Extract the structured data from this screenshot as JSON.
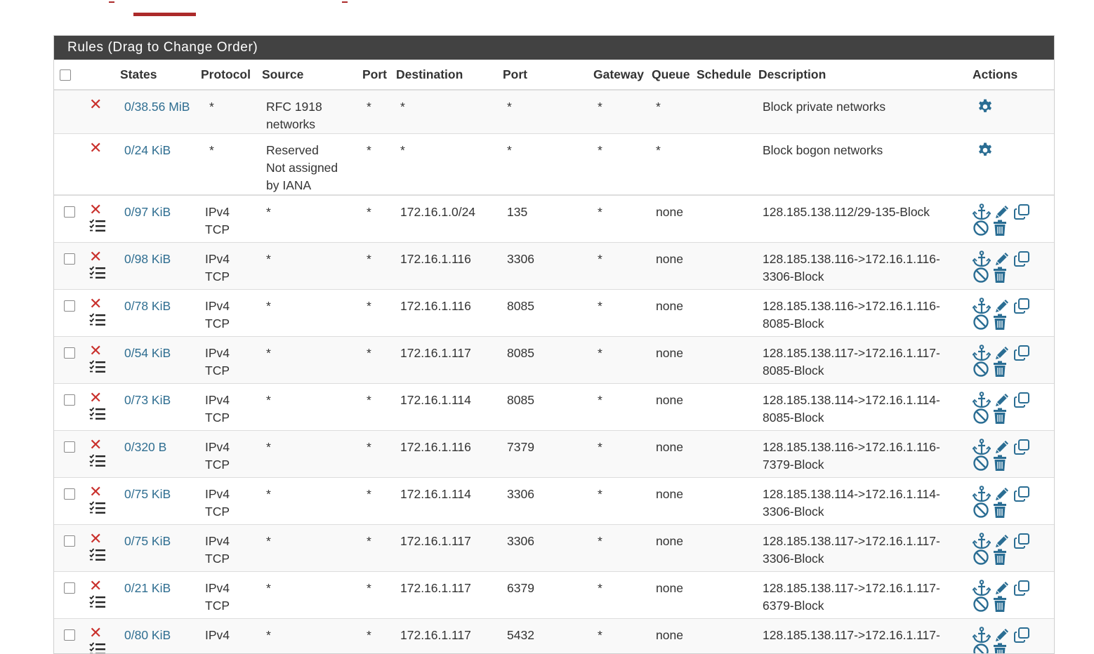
{
  "panel": {
    "title": "Rules (Drag to Change Order)"
  },
  "columns": {
    "states": "States",
    "protocol": "Protocol",
    "source": "Source",
    "source_port": "Port",
    "destination": "Destination",
    "dest_port": "Port",
    "gateway": "Gateway",
    "queue": "Queue",
    "schedule": "Schedule",
    "description": "Description",
    "actions": "Actions"
  },
  "fixed_rules": [
    {
      "states": "0/38.56 MiB",
      "protocol": "*",
      "source_line1": "RFC 1918",
      "source_line2": "networks",
      "source_line3": "",
      "source_port": "*",
      "destination": "*",
      "dest_port": "*",
      "gateway": "*",
      "queue": "*",
      "schedule": "",
      "description": "Block private networks"
    },
    {
      "states": "0/24 KiB",
      "protocol": "*",
      "source_line1": "Reserved",
      "source_line2": "Not assigned",
      "source_line3": "by IANA",
      "source_port": "*",
      "destination": "*",
      "dest_port": "*",
      "gateway": "*",
      "queue": "*",
      "schedule": "",
      "description": "Block bogon networks"
    }
  ],
  "rules": [
    {
      "states": "0/97 KiB",
      "proto1": "IPv4",
      "proto2": "TCP",
      "source": "*",
      "source_port": "*",
      "destination": "172.16.1.0/24",
      "dest_port": "135",
      "gateway": "*",
      "queue": "none",
      "schedule": "",
      "desc1": "128.185.138.112/29-135-Block",
      "desc2": ""
    },
    {
      "states": "0/98 KiB",
      "proto1": "IPv4",
      "proto2": "TCP",
      "source": "*",
      "source_port": "*",
      "destination": "172.16.1.116",
      "dest_port": "3306",
      "gateway": "*",
      "queue": "none",
      "schedule": "",
      "desc1": "128.185.138.116->172.16.1.116-",
      "desc2": "3306-Block"
    },
    {
      "states": "0/78 KiB",
      "proto1": "IPv4",
      "proto2": "TCP",
      "source": "*",
      "source_port": "*",
      "destination": "172.16.1.116",
      "dest_port": "8085",
      "gateway": "*",
      "queue": "none",
      "schedule": "",
      "desc1": "128.185.138.116->172.16.1.116-",
      "desc2": "8085-Block"
    },
    {
      "states": "0/54 KiB",
      "proto1": "IPv4",
      "proto2": "TCP",
      "source": "*",
      "source_port": "*",
      "destination": "172.16.1.117",
      "dest_port": "8085",
      "gateway": "*",
      "queue": "none",
      "schedule": "",
      "desc1": "128.185.138.117->172.16.1.117-",
      "desc2": "8085-Block"
    },
    {
      "states": "0/73 KiB",
      "proto1": "IPv4",
      "proto2": "TCP",
      "source": "*",
      "source_port": "*",
      "destination": "172.16.1.114",
      "dest_port": "8085",
      "gateway": "*",
      "queue": "none",
      "schedule": "",
      "desc1": "128.185.138.114->172.16.1.114-",
      "desc2": "8085-Block"
    },
    {
      "states": "0/320 B",
      "proto1": "IPv4",
      "proto2": "TCP",
      "source": "*",
      "source_port": "*",
      "destination": "172.16.1.116",
      "dest_port": "7379",
      "gateway": "*",
      "queue": "none",
      "schedule": "",
      "desc1": "128.185.138.116->172.16.1.116-",
      "desc2": "7379-Block"
    },
    {
      "states": "0/75 KiB",
      "proto1": "IPv4",
      "proto2": "TCP",
      "source": "*",
      "source_port": "*",
      "destination": "172.16.1.114",
      "dest_port": "3306",
      "gateway": "*",
      "queue": "none",
      "schedule": "",
      "desc1": "128.185.138.114->172.16.1.114-",
      "desc2": "3306-Block"
    },
    {
      "states": "0/75 KiB",
      "proto1": "IPv4",
      "proto2": "TCP",
      "source": "*",
      "source_port": "*",
      "destination": "172.16.1.117",
      "dest_port": "3306",
      "gateway": "*",
      "queue": "none",
      "schedule": "",
      "desc1": "128.185.138.117->172.16.1.117-",
      "desc2": "3306-Block"
    },
    {
      "states": "0/21 KiB",
      "proto1": "IPv4",
      "proto2": "TCP",
      "source": "*",
      "source_port": "*",
      "destination": "172.16.1.117",
      "dest_port": "6379",
      "gateway": "*",
      "queue": "none",
      "schedule": "",
      "desc1": "128.185.138.117->172.16.1.117-",
      "desc2": "6379-Block"
    },
    {
      "states": "0/80 KiB",
      "proto1": "IPv4",
      "proto2": "",
      "source": "*",
      "source_port": "*",
      "destination": "172.16.1.117",
      "dest_port": "5432",
      "gateway": "*",
      "queue": "none",
      "schedule": "",
      "desc1": "128.185.138.117->172.16.1.117-",
      "desc2": ""
    }
  ],
  "icons": {
    "block": "close-icon",
    "advanced": "tasks-list-icon",
    "gear": "gear-icon",
    "anchor": "anchor-icon",
    "edit": "pencil-icon",
    "copy": "copy-icon",
    "disable": "ban-icon",
    "delete": "trash-icon"
  },
  "colors": {
    "accent_red": "#ac2a2a",
    "block_red": "#c9302c",
    "link_blue": "#2f6e91",
    "icon_blue": "#2a6d93",
    "header_dark": "#424242"
  }
}
